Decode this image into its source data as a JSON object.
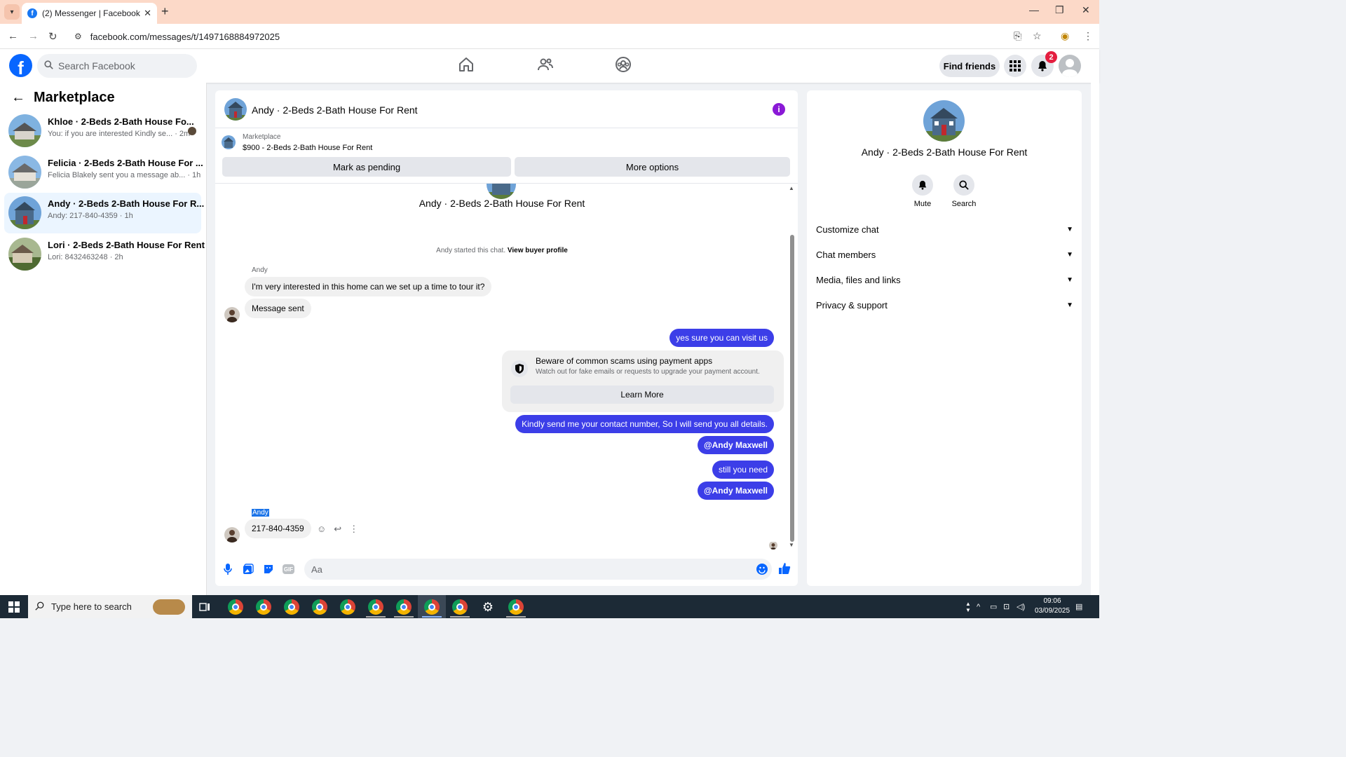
{
  "browser": {
    "tab_title": "(2) Messenger | Facebook",
    "url": "facebook.com/messages/t/1497168884972025"
  },
  "fb_header": {
    "search_placeholder": "Search Facebook",
    "find_friends": "Find friends",
    "notification_count": "2"
  },
  "sidebar": {
    "title": "Marketplace",
    "conversations": [
      {
        "name": "Khloe · 2-Beds 2-Bath House Fo...",
        "preview": "You: if you are interested Kindly se... · 2m",
        "active": false
      },
      {
        "name": "Felicia · 2-Beds 2-Bath House For ...",
        "preview": "Felicia Blakely sent you a message ab... · 1h",
        "active": false
      },
      {
        "name": "Andy · 2-Beds 2-Bath House For R...",
        "preview": "Andy: 217-840-4359 · 1h",
        "active": true
      },
      {
        "name": "Lori · 2-Beds 2-Bath House For Rent",
        "preview": "Lori: 8432463248 · 2h",
        "active": false
      }
    ]
  },
  "chat": {
    "header_name": "Andy · 2-Beds 2-Bath House For Rent",
    "marketplace_label": "Marketplace",
    "listing": "$900 - 2-Beds 2-Bath House For Rent",
    "mark_pending": "Mark as pending",
    "more_options": "More options",
    "conversation_title": "Andy · 2-Beds 2-Bath House For Rent",
    "started_text": "Andy started this chat.",
    "view_buyer_profile": "View buyer profile",
    "sender_name": "Andy",
    "messages": {
      "in_1": "I'm very interested in this home can we set up a time to tour it?",
      "in_2": "Message sent",
      "out_1": "yes sure you can visit us",
      "warning_title": "Beware of common scams using payment apps",
      "warning_sub": "Watch out for fake emails or requests to upgrade your payment account.",
      "learn_more": "Learn More",
      "out_2": "Kindly send me your contact number, So I will send you all details.",
      "out_3": "@Andy Maxwell",
      "out_4": "still you need",
      "out_5": "@Andy Maxwell",
      "in_3": "217-840-4359"
    },
    "composer_placeholder": "Aa",
    "gif_label": "GIF"
  },
  "info_panel": {
    "name": "Andy · 2-Beds 2-Bath House For Rent",
    "mute": "Mute",
    "search": "Search",
    "sections": [
      "Customize chat",
      "Chat members",
      "Media, files and links",
      "Privacy & support"
    ]
  },
  "taskbar": {
    "search_placeholder": "Type here to search",
    "time": "09:06",
    "date": "03/09/2025"
  },
  "colors": {
    "accent": "#0866ff",
    "outgoing_bubble": "#3c3ee8",
    "info_icon": "#8a19d6"
  }
}
